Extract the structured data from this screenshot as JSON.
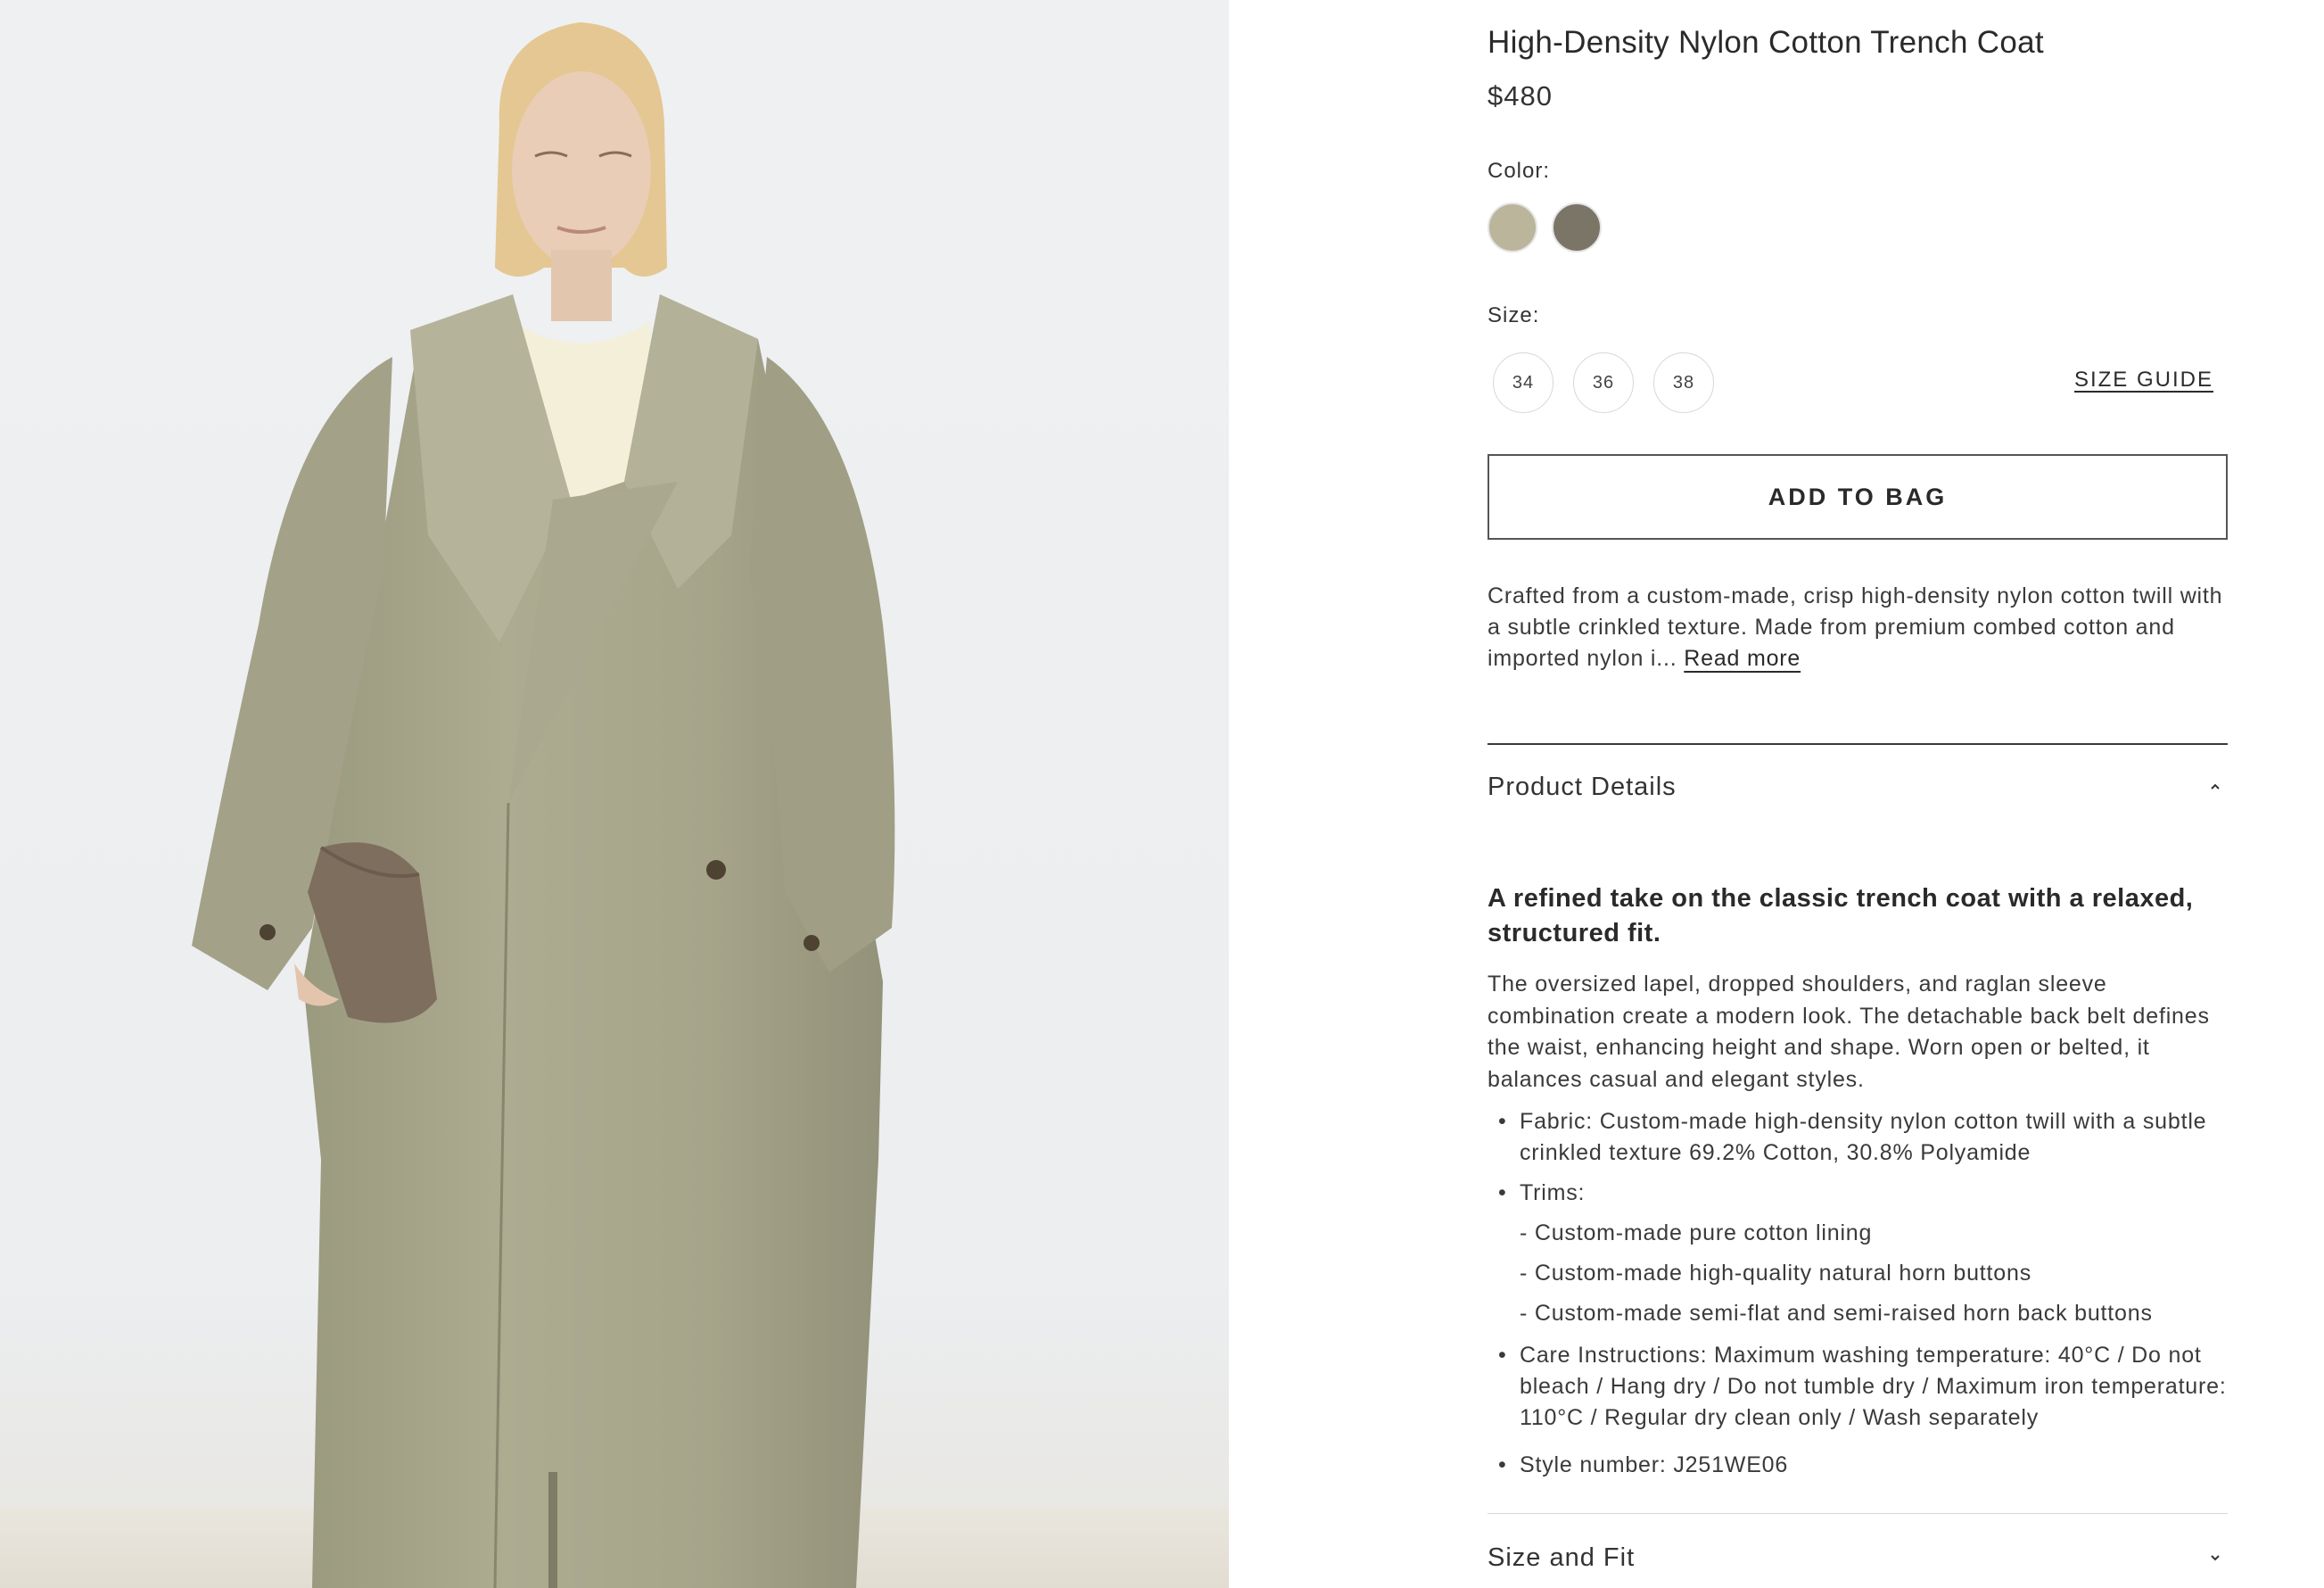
{
  "product": {
    "title": "High-Density Nylon Cotton Trench Coat",
    "price": "$480",
    "image_alt": "Model wearing oversized khaki trench coat holding brown suede clutch"
  },
  "color": {
    "label": "Color:",
    "swatches": [
      {
        "name": "khaki",
        "hex": "#bab59b"
      },
      {
        "name": "taupe",
        "hex": "#7b7568"
      }
    ]
  },
  "size": {
    "label": "Size:",
    "options": [
      "34",
      "36",
      "38"
    ],
    "guide_label": "SIZE GUIDE"
  },
  "add_to_bag_label": "ADD TO BAG",
  "description": {
    "text": "Crafted from a custom-made, crisp high-density nylon cotton twill with a subtle crinkled texture. Made from premium combed cotton and imported nylon i...",
    "read_more": "Read more"
  },
  "details": {
    "heading": "Product Details",
    "lead": "A refined take on the classic trench coat with a relaxed, structured fit.",
    "body": "The oversized lapel, dropped shoulders, and raglan sleeve combination create a modern look. The detachable back belt defines the waist, enhancing height and shape. Worn open or belted, it balances casual and elegant styles.",
    "bullets": {
      "fabric": "Fabric: Custom-made high-density nylon cotton twill with a subtle crinkled texture 69.2% Cotton, 30.8% Polyamide",
      "trims": "Trims:",
      "trim_items": [
        "- Custom-made pure cotton lining",
        "- Custom-made high-quality natural horn buttons",
        "- Custom-made semi-flat and semi-raised horn back buttons"
      ],
      "care": "Care Instructions: Maximum washing temperature: 40°C / Do not bleach / Hang dry / Do not tumble dry / Maximum iron temperature: 110°C / Regular dry clean only / Wash separately",
      "style": "Style number: J251WE06"
    }
  },
  "size_fit": {
    "heading": "Size and Fit"
  }
}
